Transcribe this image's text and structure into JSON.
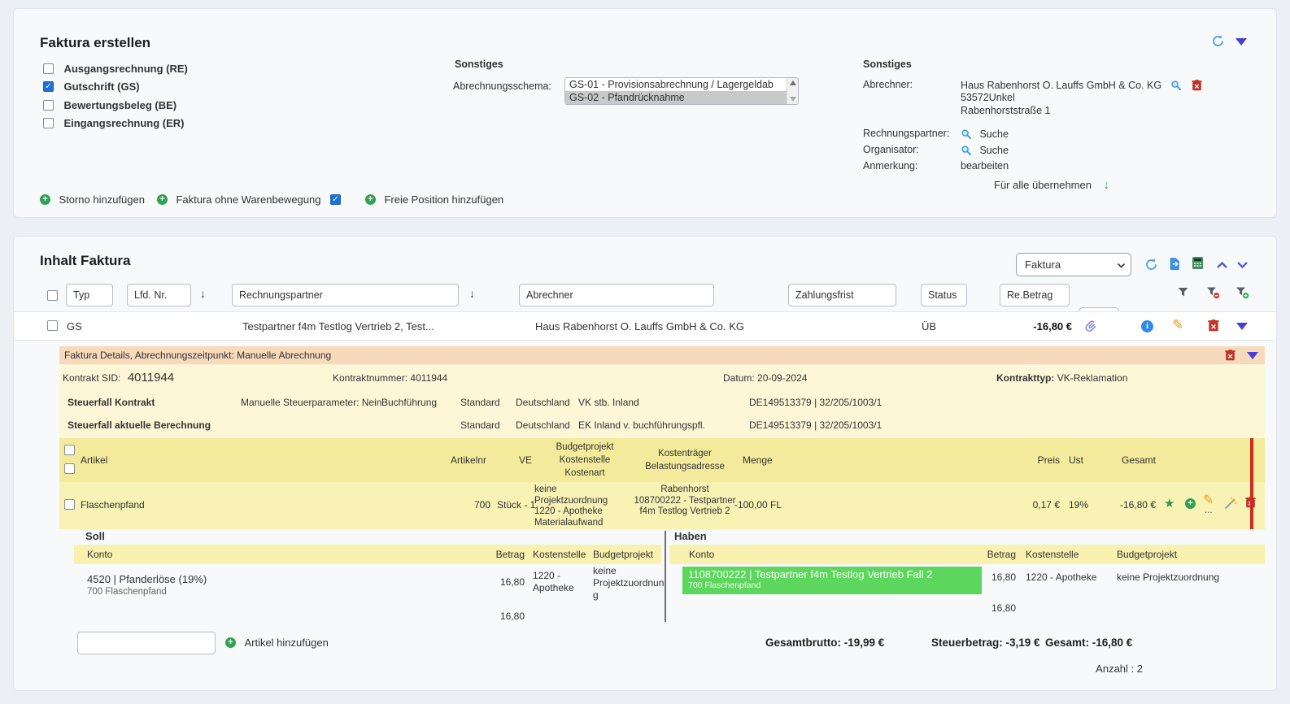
{
  "icons": {
    "check": "✓",
    "sort_down": "↓",
    "apply_down": "↓",
    "star": "★",
    "pencil": "✎",
    "info": "i",
    "plus": "+",
    "ellipsis": "..."
  },
  "colors": {
    "accent_blue": "#2f8be4",
    "green": "#2ea44f",
    "red": "#c0392b",
    "indigo": "#4a40cf",
    "orange_bar": "#f7d9bc",
    "yellow_panel": "#fdf7d8",
    "yellow_header": "#f3eb9b",
    "yellow_row": "#f8f2b5",
    "highlight_green": "#5cd65c"
  },
  "create": {
    "title": "Faktura erstellen",
    "types": [
      {
        "label": "Ausgangsrechnung (RE)",
        "checked": false
      },
      {
        "label": "Gutschrift (GS)",
        "checked": true
      },
      {
        "label": "Bewertungsbeleg (BE)",
        "checked": false
      },
      {
        "label": "Eingangsrechnung (ER)",
        "checked": false
      }
    ],
    "schema": {
      "heading": "Sonstiges",
      "label": "Abrechnungsschema:",
      "options": [
        {
          "text": "GS-01 - Provisionsabrechnung / Lagergeldab",
          "selected": false
        },
        {
          "text": "GS-02 - Pfandrücknahme",
          "selected": true
        }
      ]
    },
    "party": {
      "heading": "Sonstiges",
      "abrechner_label": "Abrechner:",
      "abrechner_name": "Haus Rabenhorst O. Lauffs GmbH & Co. KG",
      "abrechner_line2": "53572Unkel",
      "abrechner_line3": "Rabenhorststraße 1",
      "rechnungspartner_label": "Rechnungspartner:",
      "rechnungspartner_action": "Suche",
      "organisator_label": "Organisator:",
      "organisator_action": "Suche",
      "anmerkung_label": "Anmerkung:",
      "anmerkung_action": "bearbeiten",
      "apply_all_label": "Für alle übernehmen"
    },
    "actions": {
      "storno": "Storno hinzufügen",
      "ohne_warenbewegung": "Faktura ohne Warenbewegung",
      "ohne_warenbewegung_checked": true,
      "freie_position": "Freie Position hinzufügen"
    }
  },
  "invoice": {
    "title": "Inhalt Faktura",
    "view_select": "Faktura",
    "filters": {
      "typ": "Typ",
      "lfd_nr": "Lfd. Nr.",
      "rechnungspartner": "Rechnungspartner",
      "abrechner": "Abrechner",
      "zahlungsfrist": "Zahlungsfrist",
      "status": "Status",
      "re_betrag": "Re.Betrag",
      "mode_select": "--"
    },
    "row": {
      "typ": "GS",
      "rechnungspartner": "Testpartner f4m Testlog Vertrieb 2, Test...",
      "abrechner": "Haus Rabenhorst O. Lauffs GmbH & Co. KG",
      "status": "ÜB",
      "re_betrag": "-16,80 €"
    },
    "details": {
      "bar_title": "Faktura Details, Abrechnungszeitpunkt: Manuelle Abrechnung",
      "kontrakt_sid_label": "Kontrakt SID:",
      "kontrakt_sid": "4011944",
      "kontraktnummer_label": "Kontraktnummer:",
      "kontraktnummer": "4011944",
      "datum_label": "Datum:",
      "datum": "20-09-2024",
      "kontrakttyp_label": "Kontrakttyp:",
      "kontrakttyp": "VK-Reklamation",
      "steuerfall": [
        {
          "title": "Steuerfall Kontrakt",
          "param": "Manuelle Steuerparameter: Nein",
          "buchfuehrung": "Buchführung",
          "mode": "Standard",
          "land": "Deutschland",
          "art": "VK stb. Inland",
          "ref": "DE149513379 | 32/205/1003/1"
        },
        {
          "title": "Steuerfall aktuelle Berechnung",
          "param": "",
          "buchfuehrung": "",
          "mode": "Standard",
          "land": "Deutschland",
          "art": "EK Inland v. buchführungspfl.",
          "ref": "DE149513379 | 32/205/1003/1"
        }
      ]
    },
    "articles": {
      "header": {
        "artikel": "Artikel",
        "artikelnr": "Artikelnr",
        "ve": "VE",
        "budget_col": "Budgetprojekt\nKostenstelle\nKostenart",
        "kostentraeger_col": "Kostenträger\nBelastungsadresse",
        "menge": "Menge",
        "preis": "Preis",
        "ust": "Ust",
        "gesamt": "Gesamt"
      },
      "row": {
        "name": "Flaschenpfand",
        "artikelnr": "700",
        "ve": "Stück - 1",
        "budget": "keine Projektzuordnung\n1220 - Apotheke\nMaterialaufwand",
        "kostentraeger": "Rabenhorst\n108700222 - Testpartner f4m Testlog Vertrieb 2",
        "menge": "-100,00 FL",
        "preis": "0,17 €",
        "ust": "19%",
        "gesamt": "-16,80 €"
      }
    },
    "soll": {
      "title": "Soll",
      "cols": {
        "konto": "Konto",
        "betrag": "Betrag",
        "kostenstelle": "Kostenstelle",
        "budget": "Budgetprojekt"
      },
      "row": {
        "konto": "4520 | Pfanderlöse (19%)",
        "konto_sub": "700 Flaschenpfand",
        "betrag": "16,80",
        "kostenstelle": "1220 - Apotheke",
        "budget": "keine Projektzuordnung"
      },
      "total": "16,80"
    },
    "haben": {
      "title": "Haben",
      "cols": {
        "konto": "Konto",
        "betrag": "Betrag",
        "kostenstelle": "Kostenstelle",
        "budget": "Budgetprojekt"
      },
      "row": {
        "konto": "1108700222 | Testpartner f4m Testlog Vertrieb Fall 2",
        "konto_sub": "700 Flaschenpfand",
        "betrag": "16,80",
        "kostenstelle": "1220 - Apotheke",
        "budget": "keine Projektzuordnung"
      },
      "total": "16,80"
    },
    "footer": {
      "add_article": "Artikel hinzufügen",
      "gesamtbrutto": "Gesamtbrutto: -19,99 €",
      "steuerbetrag": "Steuerbetrag: -3,19 €",
      "gesamt": "Gesamt: -16,80 €",
      "anzahl": "Anzahl : 2"
    }
  }
}
